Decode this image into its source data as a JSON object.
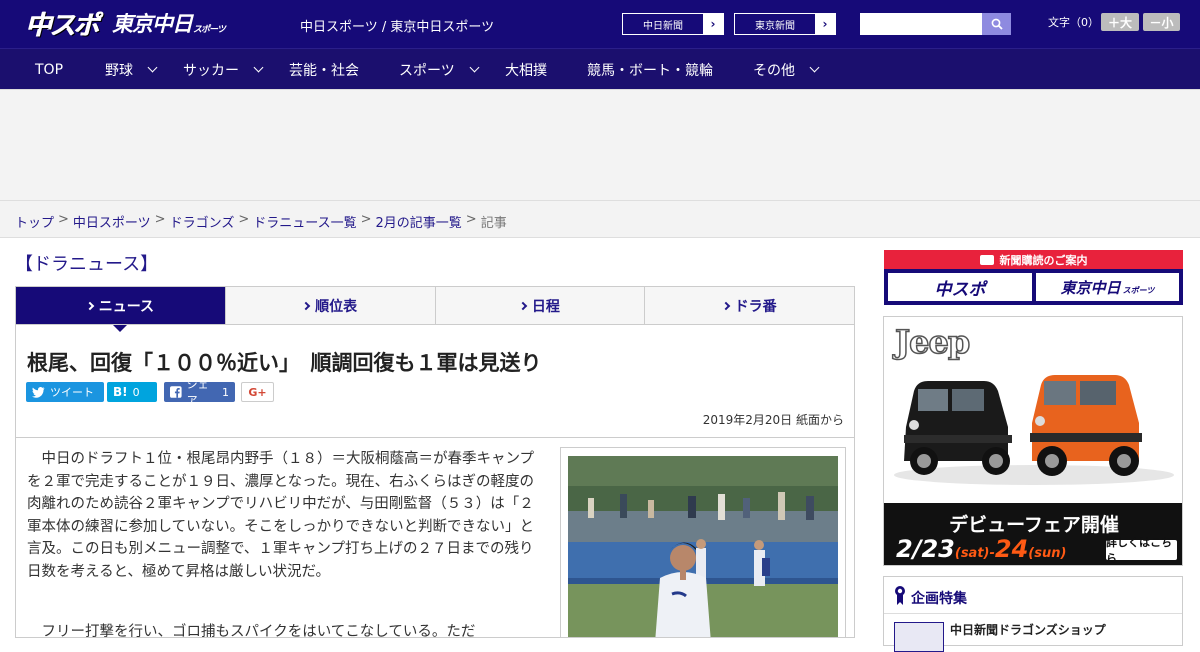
{
  "header": {
    "logo_chuspo": "中スポ",
    "logo_tokyo": "東京中日",
    "logo_tokyo_sub": "スポーツ",
    "site_name": "中日スポーツ / 東京中日スポーツ",
    "links": [
      "中日新聞",
      "東京新聞"
    ],
    "link_arrow": "›",
    "search_placeholder": "",
    "fontsize_label": "文字（0）",
    "fontsize_plus": "＋大",
    "fontsize_minus": "－小"
  },
  "nav": {
    "items": [
      "TOP",
      "野球",
      "サッカー",
      "芸能・社会",
      "スポーツ",
      "大相撲",
      "競馬・ボート・競輪",
      "その他"
    ]
  },
  "breadcrumb": {
    "items": [
      "トップ",
      "中日スポーツ",
      "ドラゴンズ",
      "ドラニュース一覧",
      "2月の記事一覧"
    ],
    "separator": ">",
    "current": "記事"
  },
  "section_title": "【ドラニュース】",
  "tabs": [
    "ニュース",
    "順位表",
    "日程",
    "ドラ番"
  ],
  "article": {
    "headline": "根尾、回復「１００％近い」　順調回復も１軍は見送り",
    "share": {
      "tweet": "ツイート",
      "hatena_icon": "B!",
      "hatena_count": "0",
      "facebook_label": "シェア",
      "facebook_count": "1",
      "gplus": "G+"
    },
    "dateline": "2019年2月20日 紙面から",
    "paragraphs": [
      "中日のドラフト１位・根尾昂内野手（１８）＝大阪桐蔭高＝が春季キャンプを２軍で完走することが１９日、濃厚となった。現在、右ふくらはぎの軽度の肉離れのため読谷２軍キャンプでリハビリ中だが、与田剛監督（５３）は「２軍本体の練習に参加していない。そこをしっかりできないと判断できない」と言及。この日も別メニュー調整で、１軍キャンプ打ち上げの２７日までの残り日数を考えると、極めて昇格は厳しい状況だ。",
      "フリー打撃を行い、ゴロ捕もスパイクをはいてこなしている。ただ"
    ]
  },
  "sidebar": {
    "subscribe_title": "新聞購読のご案内",
    "subscribe_btn_1": "中スポ",
    "subscribe_btn_2": "東京中日",
    "subscribe_btn_2_sub": "スポーツ",
    "jeep_logo": "Jeep",
    "jeep_title": "デビューフェア開催",
    "jeep_date_a": "2/",
    "jeep_date_b": "23",
    "jeep_date_c": "(sat)-",
    "jeep_date_d": "24",
    "jeep_date_e": "(sun)",
    "jeep_more": "詳しくはこちら",
    "feature_title": "企画特集",
    "feature_item": "中日新聞ドラゴンズショップ"
  },
  "colors": {
    "brand_navy": "#160a78",
    "nav_bg": "#1b0f6e",
    "link": "#23198a",
    "accent_red": "#e8223c",
    "jeep_orange": "#ff5a14"
  }
}
